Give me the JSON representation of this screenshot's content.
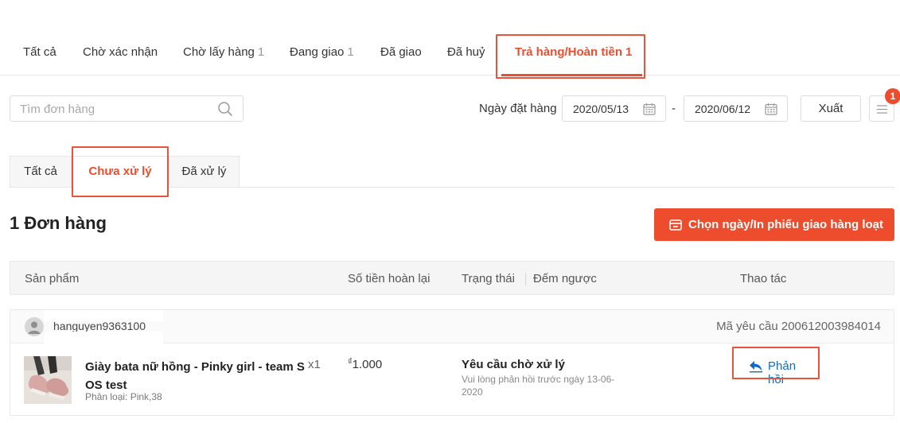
{
  "top_tabs": [
    {
      "label": "Tất cả",
      "count": ""
    },
    {
      "label": "Chờ xác nhận",
      "count": ""
    },
    {
      "label": "Chờ lấy hàng",
      "count": "1"
    },
    {
      "label": "Đang giao",
      "count": "1"
    },
    {
      "label": "Đã giao",
      "count": ""
    },
    {
      "label": "Đã huỷ",
      "count": ""
    },
    {
      "label": "Trả hàng/Hoàn tiền",
      "count": "1",
      "active": true
    }
  ],
  "search": {
    "placeholder": "Tìm đơn hàng",
    "value": ""
  },
  "filter": {
    "date_label": "Ngày đặt hàng",
    "date_from": "2020/05/13",
    "date_separator": "-",
    "date_to": "2020/06/12",
    "export_label": "Xuất",
    "notification_badge": "1"
  },
  "sub_tabs": [
    {
      "label": "Tất cả"
    },
    {
      "label": "Chưa xử lý",
      "active": true
    },
    {
      "label": "Đã xử lý"
    }
  ],
  "order_count_label": "1 Đơn hàng",
  "batch_button_label": "Chọn ngày/In phiếu giao hàng loạt",
  "table_headers": {
    "product": "Sản phẩm",
    "refund_amount": "Số tiền hoàn lại",
    "status": "Trạng thái",
    "countdown": "Đếm ngược",
    "actions": "Thao tác"
  },
  "order": {
    "username": "hanguyen9363100",
    "request_id": "Mã yêu cầu 200612003984014",
    "product_name": "Giày bata nữ hồng - Pinky girl - team S OS test",
    "quantity": "x1",
    "variant": "Phân loại: Pink,38",
    "currency": "₫",
    "amount": "1.000",
    "status": "Yêu cầu chờ xử lý",
    "status_note": "Vui lòng phản hồi trước ngày 13-06-2020",
    "reply_label": "Phản hồi"
  },
  "colors": {
    "accent": "#ee4d2d",
    "link": "#0d6cc8",
    "highlight_box": "#e6543a"
  }
}
